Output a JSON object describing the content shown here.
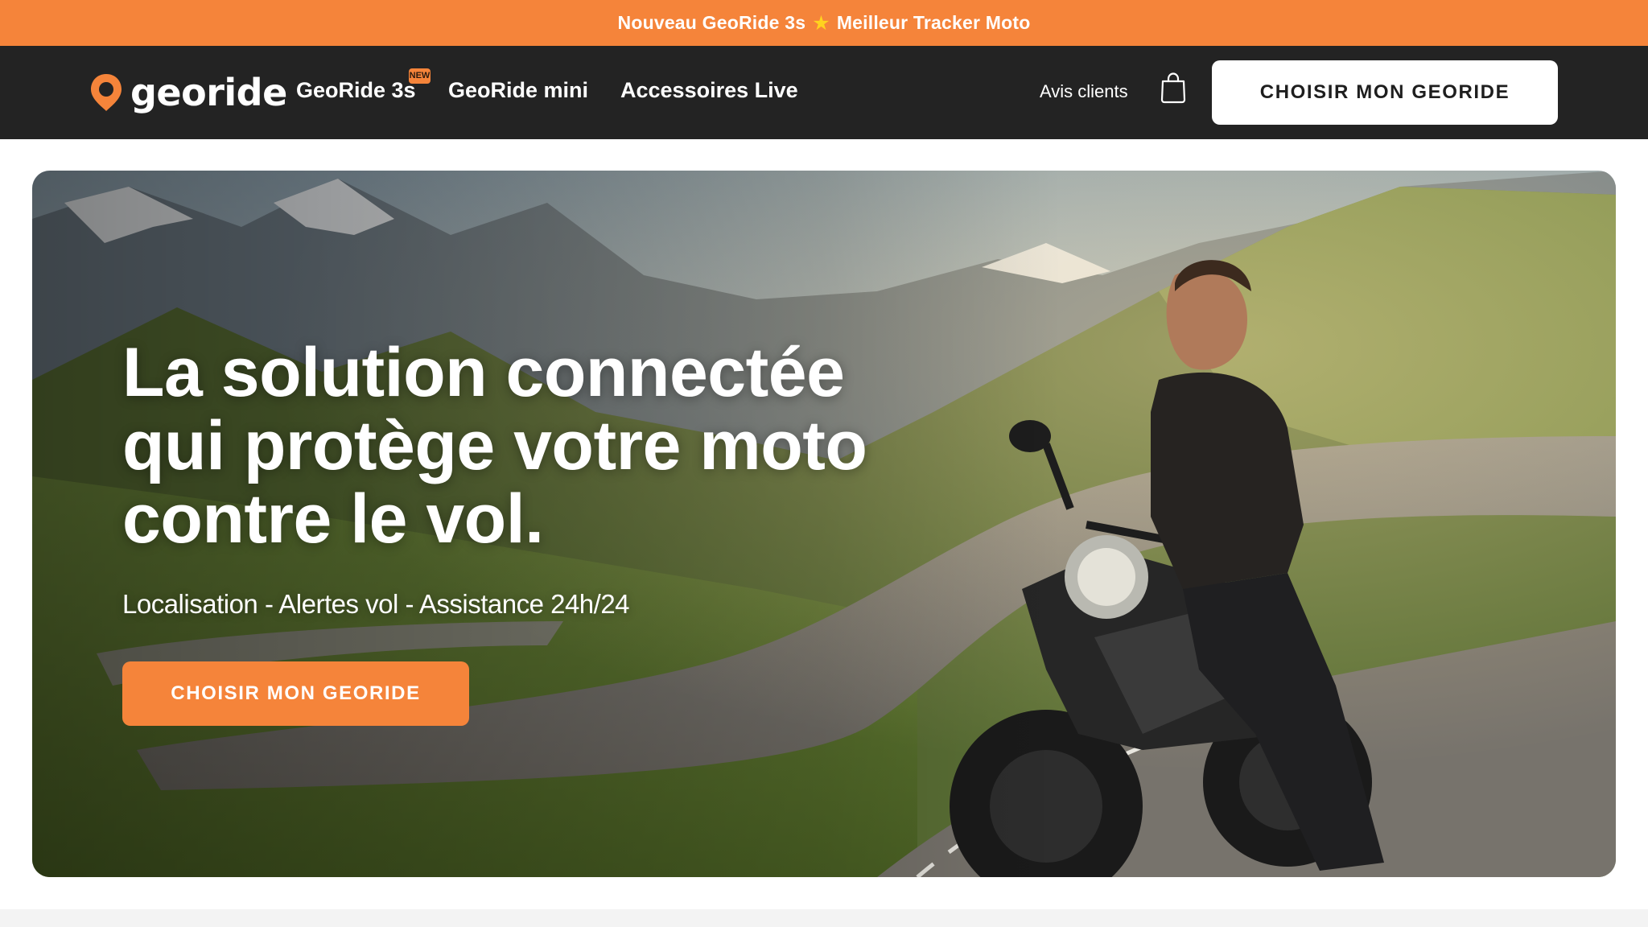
{
  "announcement": {
    "text_before": "Nouveau GeoRide 3s",
    "star_icon": "star-icon",
    "text_after": "Meilleur Tracker Moto"
  },
  "header": {
    "logo_text": "georide",
    "nav": [
      {
        "label": "GeoRide 3s",
        "badge": "NEW"
      },
      {
        "label": "GeoRide mini"
      },
      {
        "label": "Accessoires Live"
      }
    ],
    "reviews_link": "Avis clients",
    "cart_icon": "shopping-bag-icon",
    "cta_label": "CHOISIR MON GEORIDE"
  },
  "hero": {
    "title_lines": [
      "La solution connectée",
      "qui protège votre moto",
      "contre le vol."
    ],
    "subtitle": "Localisation - Alertes vol - Assistance 24h/24",
    "cta_label": "CHOISIR MON GEORIDE"
  },
  "colors": {
    "accent": "#f5843a",
    "nav_bg": "#232323",
    "text_light": "#ffffff"
  }
}
